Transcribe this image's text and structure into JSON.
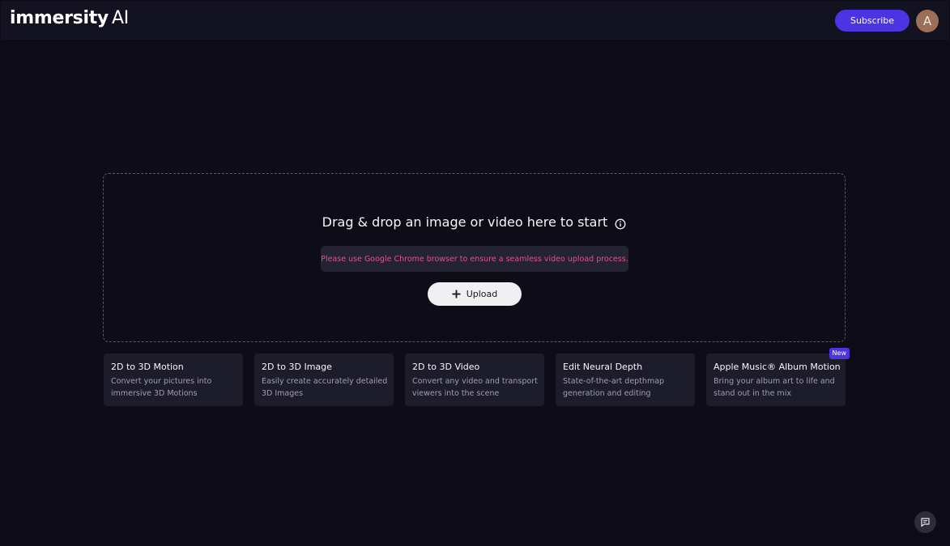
{
  "header": {
    "logo_text": "immersity",
    "logo_suffix": "AI",
    "subscribe_label": "Subscribe",
    "avatar_initial": "A"
  },
  "dropzone": {
    "title": "Drag & drop an image or video here to start",
    "notice": "Please use Google Chrome browser to ensure a seamless video upload process.",
    "upload_label": "Upload"
  },
  "cards": [
    {
      "title": "2D to 3D Motion",
      "description": "Convert your pictures into immersive 3D Motions"
    },
    {
      "title": "2D to 3D Image",
      "description": "Easily create accurately detailed 3D Images"
    },
    {
      "title": "2D to 3D Video",
      "description": "Convert any video and transport viewers into the scene"
    },
    {
      "title": "Edit Neural Depth",
      "description": "State-of-the-art depthmap generation and editing"
    },
    {
      "title": "Apple Music® Album Motion",
      "description": "Bring your album art to life and stand out in the mix",
      "badge": "New"
    }
  ],
  "colors": {
    "background": "#0d0c17",
    "accent": "#4c33e3",
    "notice_text": "#e0538c",
    "card_bg": "#1d1c2a"
  },
  "icons": {
    "info": "info-circle-icon",
    "upload": "plus-icon",
    "chat": "chat-icon"
  }
}
